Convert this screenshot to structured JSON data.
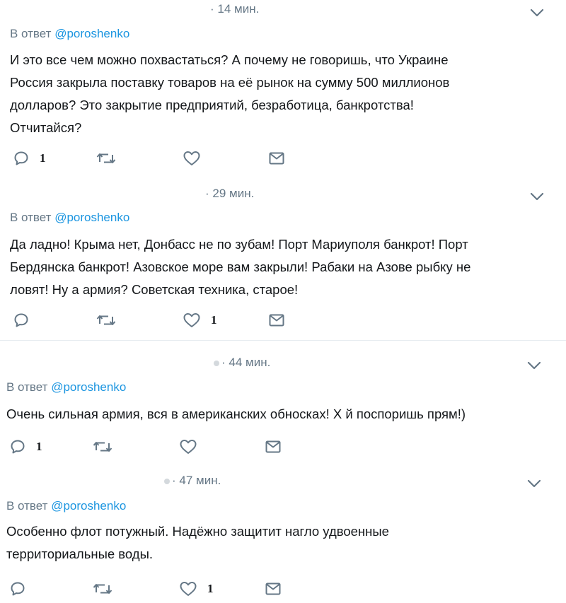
{
  "tweets": [
    {
      "time": "· 14 мин.",
      "reply_prefix": "В ответ",
      "reply_handle": "@poroshenko",
      "lines": [
        "И это все чем можно похвастаться? А почему не говоришь, что Украине",
        "Россия закрыла поставку товаров на её рынок на сумму 500 миллионов",
        "долларов? Это закрытие предприятий, безработица, банкротства!",
        "Отчитайся?"
      ],
      "reply_count": "1",
      "retweet_count": "",
      "like_count": ""
    },
    {
      "time": "· 29 мин.",
      "reply_prefix": "В ответ",
      "reply_handle": "@poroshenko",
      "lines": [
        "Да ладно! Крыма нет, Донбасс не по зубам! Порт Мариуполя банкрот! Порт",
        "Бердянска банкрот! Азовское море вам закрыли! Рабаки на Азове рыбку не",
        "ловят! Ну а армия? Советская техника, старое!"
      ],
      "reply_count": "",
      "retweet_count": "",
      "like_count": "1"
    },
    {
      "time": "· 44 мин.",
      "reply_prefix": "В ответ",
      "reply_handle": "@poroshenko",
      "lines": [
        "Очень сильная армия, вся в американских обносках! Х  й поспоришь прям!)"
      ],
      "reply_count": "1",
      "retweet_count": "",
      "like_count": ""
    },
    {
      "time": "· 47 мин.",
      "reply_prefix": "В ответ",
      "reply_handle": "@poroshenko",
      "lines": [
        "Особенно флот потужный. Надёжно защитит нагло удвоенные",
        "территориальные воды."
      ],
      "reply_count": "",
      "retweet_count": "",
      "like_count": "1"
    }
  ],
  "colors": {
    "icon": "#657786",
    "handle": "#1b95e0",
    "text": "#14171a",
    "muted": "#657786",
    "divider": "#e6ecf0"
  },
  "icons": {
    "reply": "reply-icon",
    "retweet": "retweet-icon",
    "like": "heart-icon",
    "message": "envelope-icon",
    "more": "chevron-down-icon"
  }
}
